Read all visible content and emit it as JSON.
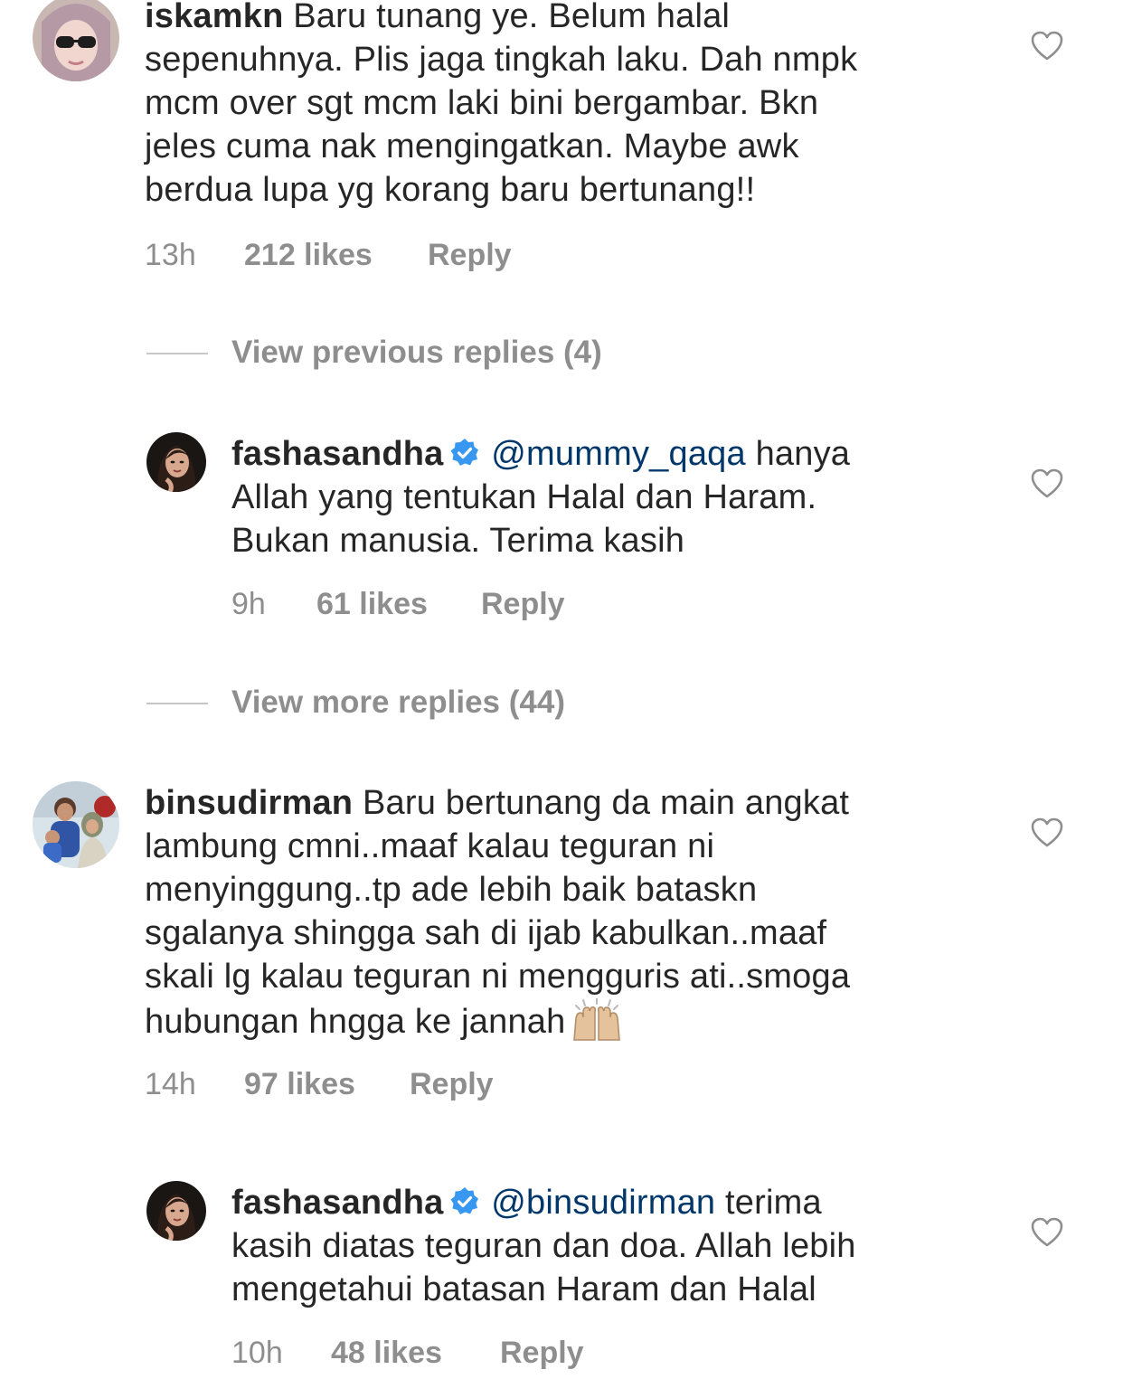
{
  "comments": [
    {
      "username": "iskamkn",
      "text": "Baru tunang ye. Belum halal\nsepenuhnya. Plis jaga tingkah laku. Dah nmpk\nmcm over sgt mcm laki bini bergambar. Bkn\njeles cuma nak mengingatkan. Maybe awk\nberdua lupa yg korang baru bertunang!!",
      "time": "13h",
      "likes": "212 likes",
      "reply_label": "Reply"
    },
    {
      "username": "binsudirman",
      "text": "Baru bertunang da main angkat\nlambung cmni..maaf kalau teguran ni\nmenyinggung..tp ade lebih baik bataskn\nsgalanya shingga sah di ijab kabulkan..maaf\nskali lg kalau teguran ni mengguris ati..smoga\nhubungan hngga ke jannah",
      "emoji": "raised-hands-emoji",
      "time": "14h",
      "likes": "97 likes",
      "reply_label": "Reply"
    }
  ],
  "replies": [
    {
      "username": "fashasandha",
      "verified": true,
      "mention": "@mummy_qaqa",
      "text": " hanya\nAllah yang tentukan Halal dan Haram.\nBukan manusia. Terima kasih",
      "time": "9h",
      "likes": "61 likes",
      "reply_label": "Reply"
    },
    {
      "username": "fashasandha",
      "verified": true,
      "mention": "@binsudirman",
      "text": " terima\nkasih diatas teguran dan doa. Allah lebih\nmengetahui batasan Haram dan Halal",
      "time": "10h",
      "likes": "48 likes",
      "reply_label": "Reply"
    }
  ],
  "view_previous_replies": "View previous replies (4)",
  "view_more_replies": "View more replies (44)",
  "colors": {
    "text": "#262626",
    "secondary": "#8e8e8e",
    "mention": "#00376b",
    "verified": "#3897f0"
  },
  "icons": {
    "like": "heart-outline-icon",
    "verified": "verified-badge-icon"
  }
}
